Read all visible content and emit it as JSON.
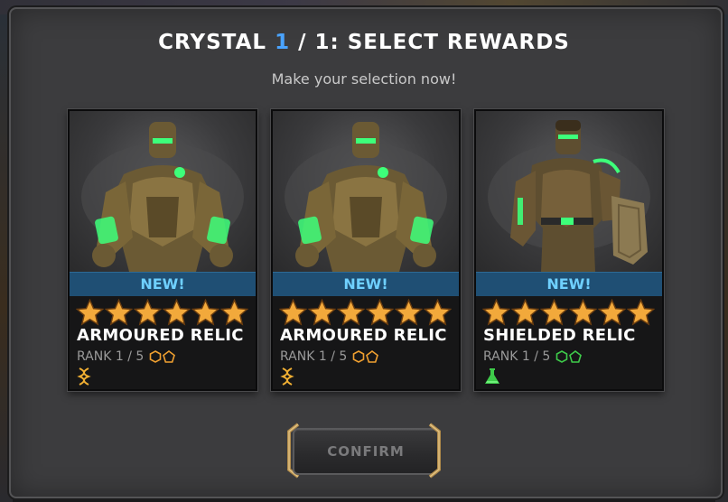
{
  "header": {
    "title_prefix": "CRYSTAL",
    "current": "1",
    "title_suffix": "/ 1: SELECT REWARDS",
    "subtitle": "Make your selection now!"
  },
  "cards": [
    {
      "badge": "NEW!",
      "stars": 6,
      "name": "ARMOURED RELIC",
      "rank_label": "RANK 1 / 5",
      "class_icon": "science-dna-icon",
      "rank_icon_color": "#f0a030"
    },
    {
      "badge": "NEW!",
      "stars": 6,
      "name": "ARMOURED RELIC",
      "rank_label": "RANK 1 / 5",
      "class_icon": "science-dna-icon",
      "rank_icon_color": "#f0a030"
    },
    {
      "badge": "NEW!",
      "stars": 6,
      "name": "SHIELDED RELIC",
      "rank_label": "RANK 1 / 5",
      "class_icon": "mutant-flask-icon",
      "rank_icon_color": "#3ecb4a"
    }
  ],
  "confirm_button": {
    "label": "CONFIRM"
  },
  "colors": {
    "accent_blue": "#4aa3ff",
    "new_text": "#6fd0ff",
    "new_bar": "#1f4f74",
    "star_gold": "#f2a93b",
    "glow_green": "#3dff7a"
  }
}
